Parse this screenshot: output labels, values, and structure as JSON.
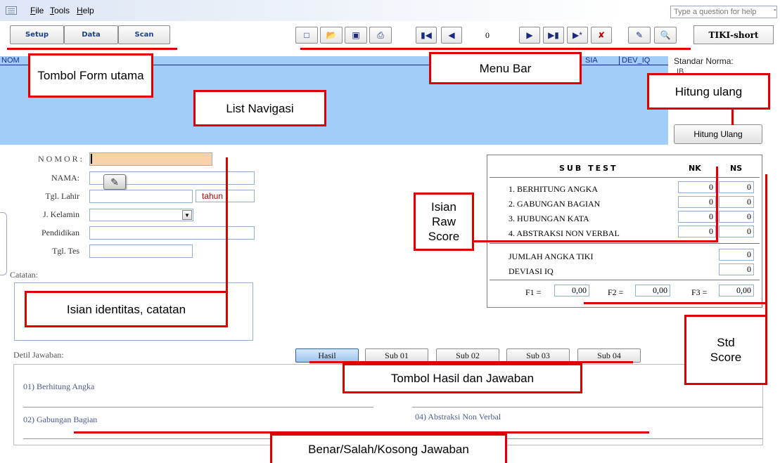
{
  "menu": {
    "items": [
      {
        "key": "F",
        "rest": "ile"
      },
      {
        "key": "T",
        "rest": "ools"
      },
      {
        "key": "H",
        "rest": "elp"
      }
    ],
    "help_placeholder": "Type a question for help",
    "help_arrow": "-"
  },
  "toolbar": {
    "setup_label": "Setup",
    "data_label": "Data",
    "scan_label": "Scan",
    "record_number": "0",
    "tiki_label": "TIKI-short",
    "icons": [
      "new-icon",
      "open-icon",
      "save-icon",
      "print-icon",
      "first-record-icon",
      "prev-record-icon",
      "next-record-icon",
      "last-record-icon",
      "new-record-icon",
      "delete-record-icon",
      "edit-icon",
      "find-icon"
    ]
  },
  "list": {
    "columns": [
      "NOM",
      "SIA",
      "DEV_IQ"
    ]
  },
  "norma": {
    "title": "Standar Norma:",
    "sub": "IB"
  },
  "hitung_button": "Hitung Ulang",
  "identity": {
    "nomor_label": "NOMOR:",
    "nama_label": "NAMA:",
    "tgl_lahir_label": "Tgl. Lahir",
    "tahun_label": "tahun",
    "jk_label": "J. Kelamin",
    "pendidikan_label": "Pendidikan",
    "tgl_tes_label": "Tgl. Tes",
    "catatan_label": "Catatan:"
  },
  "subtest": {
    "header": "SUB TEST",
    "nk_header": "NK",
    "ns_header": "NS",
    "rows": [
      {
        "label": "1. BERHITUNG ANGKA",
        "nk": "0",
        "ns": "0"
      },
      {
        "label": "2. GABUNGAN BAGIAN",
        "nk": "0",
        "ns": "0"
      },
      {
        "label": "3. HUBUNGAN KATA",
        "nk": "0",
        "ns": "0"
      },
      {
        "label": "4. ABSTRAKSI NON VERBAL",
        "nk": "0",
        "ns": "0"
      }
    ],
    "jumlah_label": "JUMLAH ANGKA TIKI",
    "jumlah_value": "0",
    "deviasi_label": "DEVIASI  IQ",
    "deviasi_value": "0",
    "f1_label": "F1 =",
    "f1_value": "0,00",
    "f2_label": "F2 =",
    "f2_value": "0,00",
    "f3_label": "F3 =",
    "f3_value": "0,00"
  },
  "detail": {
    "label": "Detil Jawaban:",
    "tabs": [
      "Hasil",
      "Sub 01",
      "Sub 02",
      "Sub 03",
      "Sub 04"
    ],
    "answers": [
      "01) Berhitung Angka",
      "02) Gabungan Bagian",
      "04) Abstraksi Non Verbal"
    ]
  },
  "annotations": {
    "tombol_form": "Tombol Form utama",
    "menu_bar": "Menu Bar",
    "list_navigasi": "List Navigasi",
    "hitung_ulang": "Hitung ulang",
    "isian_identitas": "Isian identitas, catatan",
    "isian_raw": "Isian Raw Score",
    "std_score": "Std Score",
    "tombol_hasil": "Tombol Hasil dan Jawaban",
    "benar_salah": "Benar/Salah/Kosong Jawaban"
  },
  "colors": {
    "annotation": "#e00000",
    "list_background": "#a3cdf9",
    "nomor_field": "#fbd1a9"
  }
}
